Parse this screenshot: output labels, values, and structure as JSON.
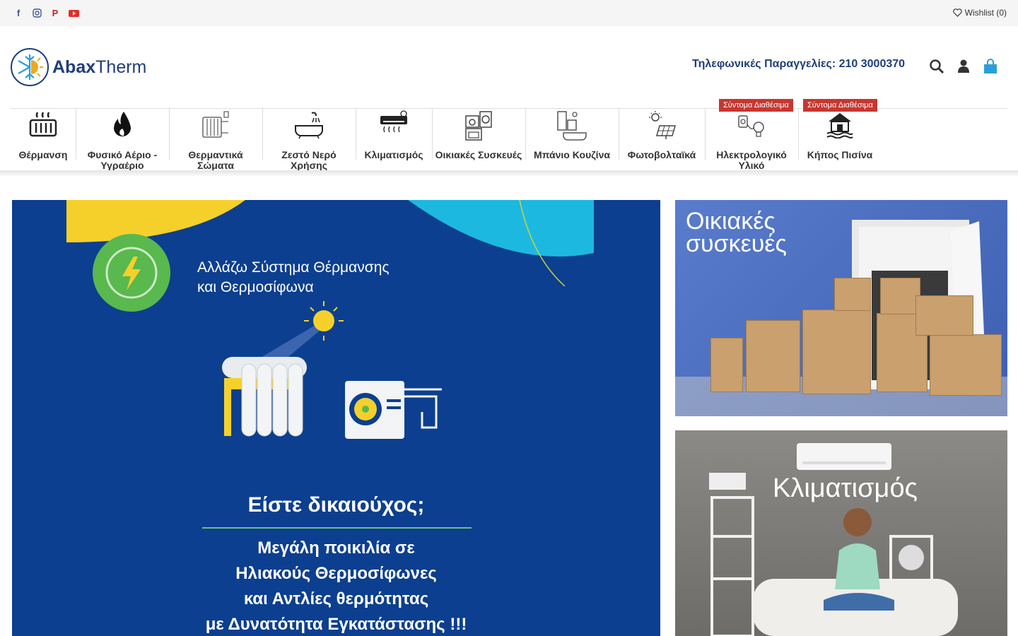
{
  "topbar": {
    "social": [
      "facebook-icon",
      "instagram-icon",
      "pinterest-icon",
      "youtube-icon"
    ],
    "wishlist_label": "Wishlist (0)"
  },
  "header": {
    "logo_bold": "Abax",
    "logo_light": "Therm",
    "phone": "Τηλεφωνικές Παραγγελίες: 210 3000370"
  },
  "nav": {
    "items": [
      {
        "label": "Θέρμανση"
      },
      {
        "label": "Φυσικό Αέριο - Υγραέριο"
      },
      {
        "label": "Θερμαντικά Σώματα"
      },
      {
        "label": "Ζεστό Νερό Χρήσης"
      },
      {
        "label": "Κλιματισμός"
      },
      {
        "label": "Οικιακές Συσκευές"
      },
      {
        "label": "Μπάνιο Κουζίνα"
      },
      {
        "label": "Φωτοβολταϊκά"
      },
      {
        "label": "Ηλεκτρολογικό Υλικό",
        "badge": "Σύντομα Διαθέσιμα"
      },
      {
        "label": "Κήπος Πισίνα",
        "badge": "Σύντομα Διαθέσιμα"
      }
    ]
  },
  "hero": {
    "line1": "Αλλάζω Σύστημα Θέρμανσης",
    "line2": "και Θερμοσίφωνα",
    "question": "Είστε δικαιούχος;",
    "body1": "Μεγάλη ποικιλία σε",
    "body2": "Ηλιακούς Θερμοσίφωνες",
    "body3": "και Αντλίες θερμότητας",
    "body4": "με Δυνατότητα Εγκατάστασης !!!"
  },
  "promos": {
    "appliances_line1": "Οικιακές",
    "appliances_line2": "συσκευές",
    "climate": "Κλιματισμός"
  },
  "colors": {
    "brand": "#1f3e7a",
    "badge": "#c7362f",
    "hero_bg": "#0c3f8f",
    "accent_blue": "#2a9fd6"
  }
}
